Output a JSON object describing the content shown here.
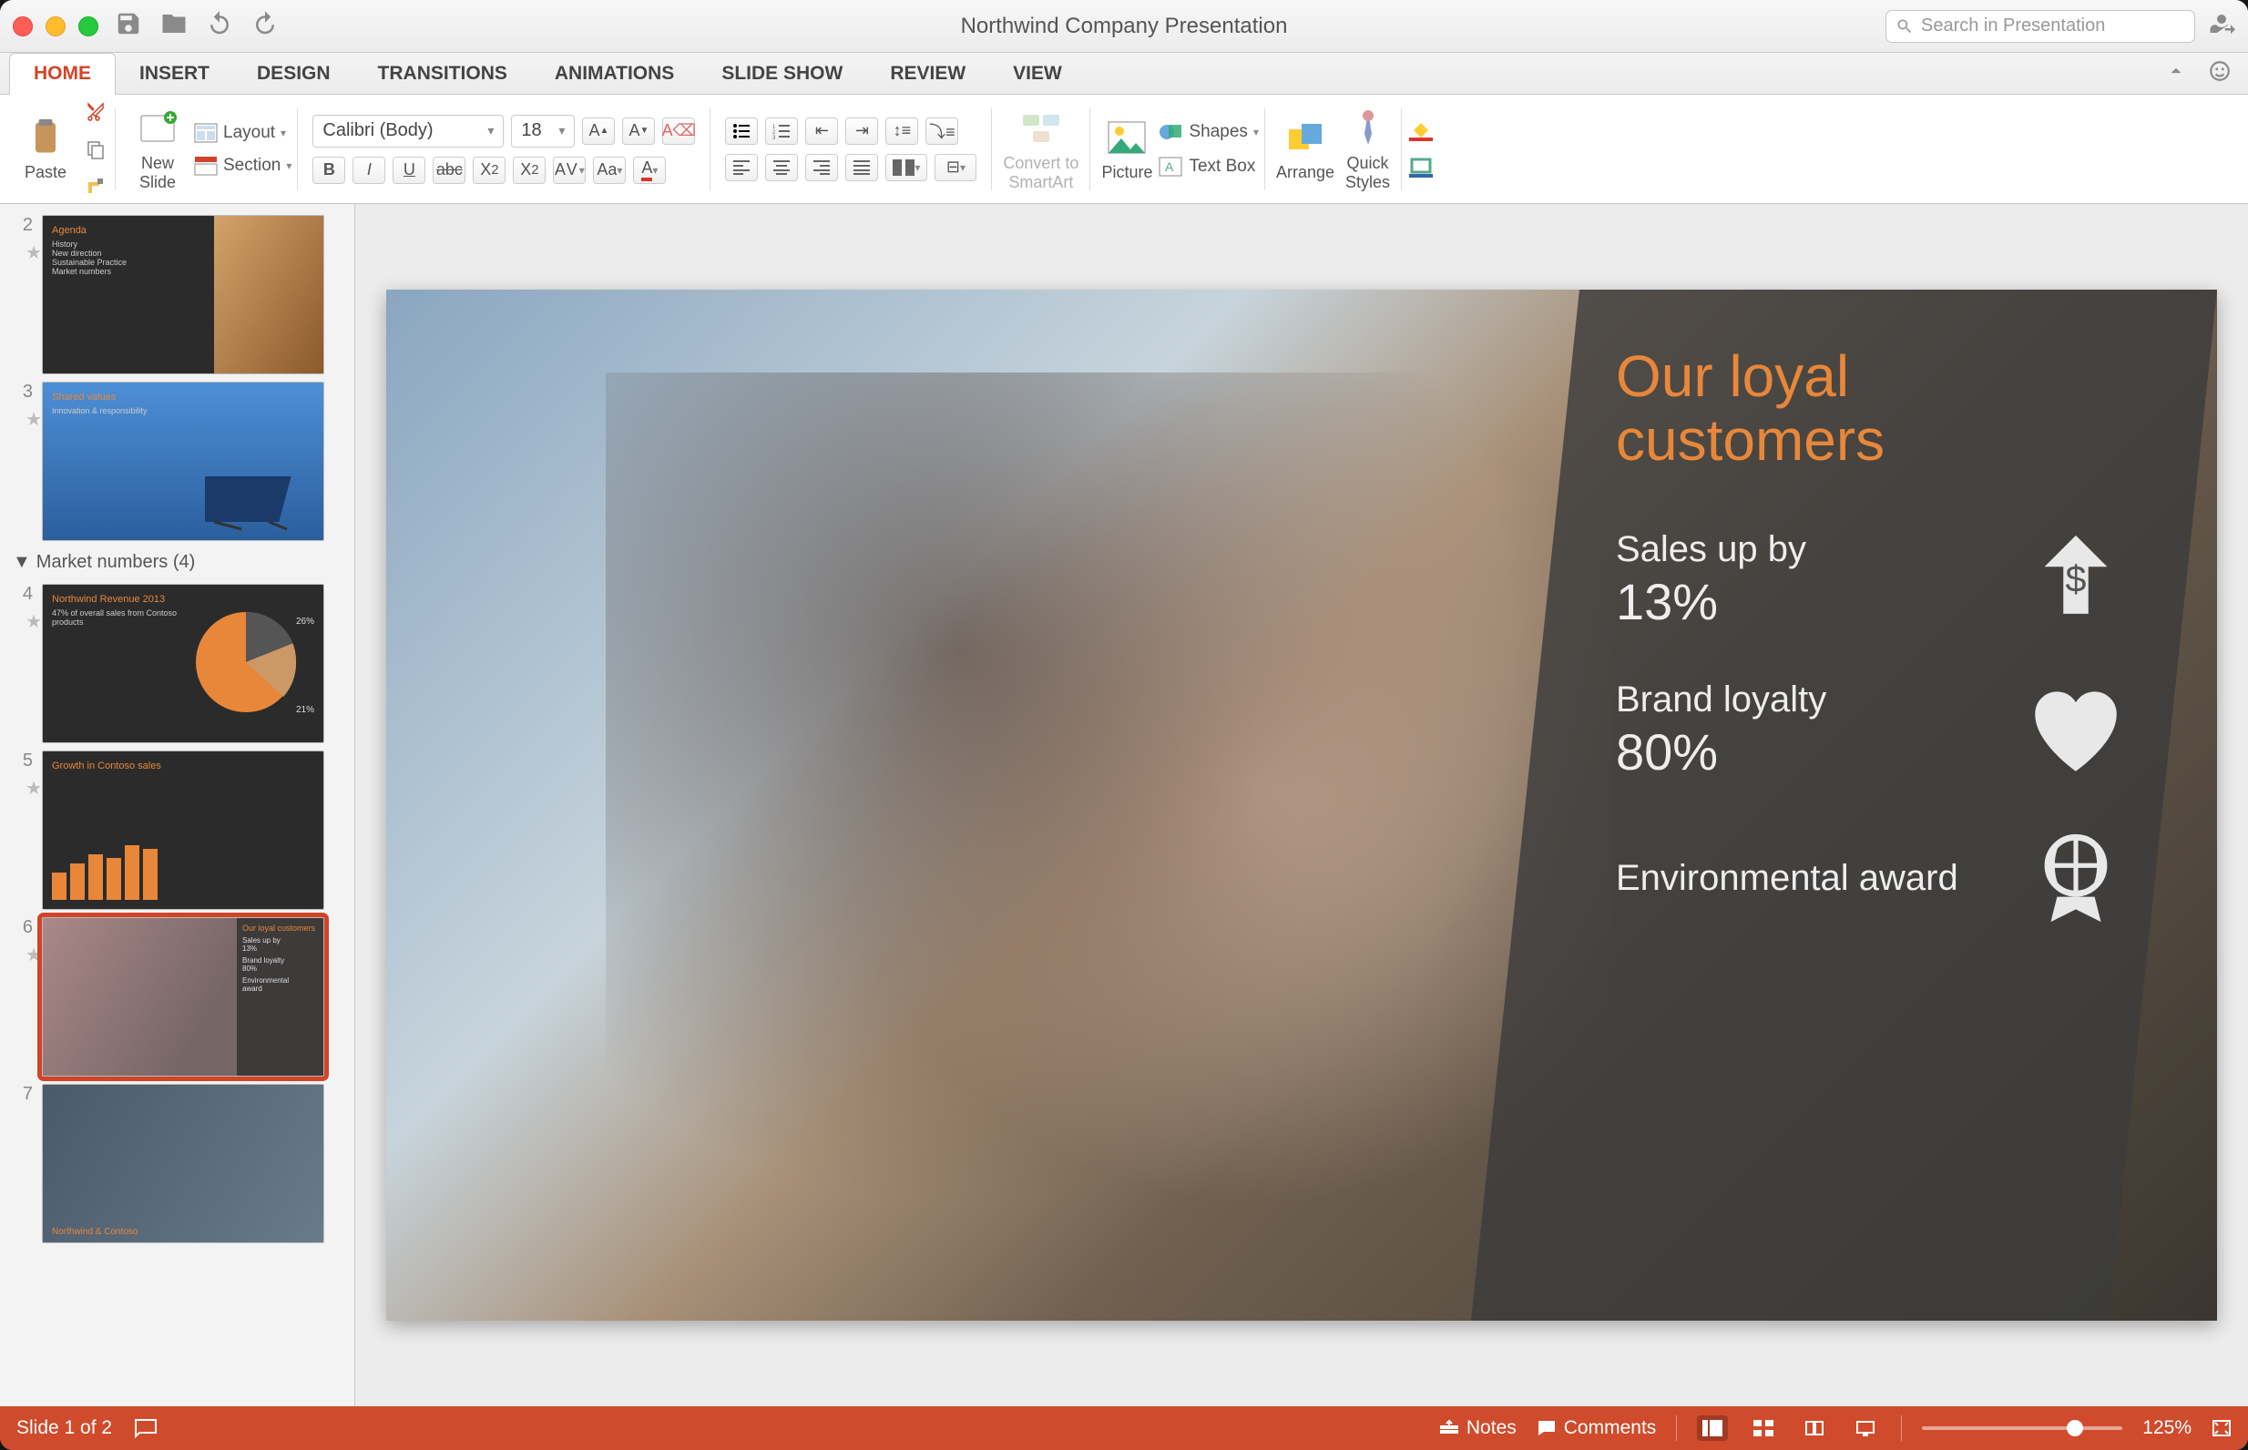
{
  "window": {
    "title": "Northwind Company Presentation"
  },
  "search": {
    "placeholder": "Search in Presentation"
  },
  "tabs": [
    "HOME",
    "INSERT",
    "DESIGN",
    "TRANSITIONS",
    "ANIMATIONS",
    "SLIDE SHOW",
    "REVIEW",
    "VIEW"
  ],
  "active_tab": "HOME",
  "ribbon": {
    "paste": "Paste",
    "new_slide": "New\nSlide",
    "layout": "Layout",
    "section": "Section",
    "font_name": "Calibri (Body)",
    "font_size": "18",
    "convert": "Convert to\nSmartArt",
    "picture": "Picture",
    "shapes": "Shapes",
    "textbox": "Text Box",
    "arrange": "Arrange",
    "quick_styles": "Quick\nStyles"
  },
  "section_header": "Market numbers (4)",
  "thumbs": [
    {
      "n": "2",
      "cls": "mini-dark",
      "title": "",
      "sub": ""
    },
    {
      "n": "3",
      "cls": "mini-blue",
      "title": "Shared values",
      "sub": "Innovation & responsibility"
    },
    {
      "n": "4",
      "cls": "mini-pie",
      "title": "Northwind Revenue 2013",
      "sub": "47% of overall sales from Contoso products"
    },
    {
      "n": "5",
      "cls": "mini-bar",
      "title": "Growth in Contoso sales",
      "sub": ""
    },
    {
      "n": "6",
      "cls": "mini-cust",
      "title": "Our loyal customers",
      "sub": "Sales up by 13%",
      "selected": true
    },
    {
      "n": "7",
      "cls": "mini-fam",
      "title": "Northwind & Contoso",
      "sub": ""
    }
  ],
  "slide": {
    "title": "Our loyal customers",
    "items": [
      {
        "label": "Sales up by",
        "value": "13%",
        "icon": "dollar-up"
      },
      {
        "label": "Brand loyalty",
        "value": "80%",
        "icon": "heart"
      },
      {
        "label": "Environmental award",
        "value": "",
        "icon": "globe-award"
      }
    ]
  },
  "status": {
    "slide_counter": "Slide 1 of 2",
    "notes": "Notes",
    "comments": "Comments",
    "zoom": "125%",
    "zoom_pos": 0.72
  }
}
